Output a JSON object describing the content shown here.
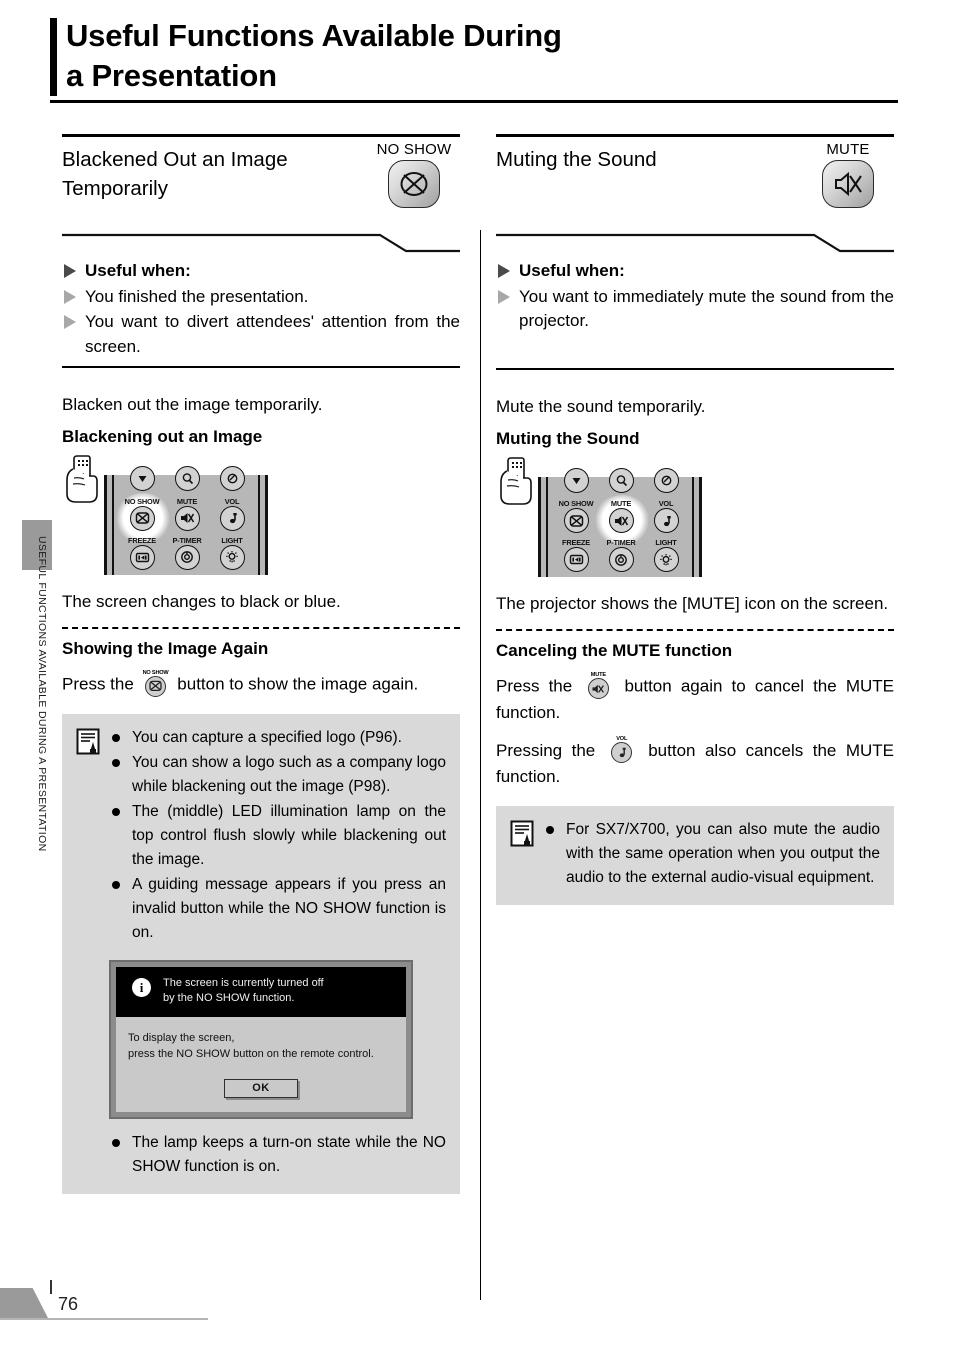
{
  "page": {
    "title_line1": "Useful Functions Available During",
    "title_line2": "a Presentation",
    "side_label": "USEFUL FUNCTIONS AVAILABLE DURING A PRESENTATION",
    "page_number": "76"
  },
  "left": {
    "section_title_line1": "Blackened Out an Image",
    "section_title_line2": "Temporarily",
    "badge_label": "NO SHOW",
    "badge_icon": "no-show-icon",
    "useful_when_heading": "Useful when:",
    "useful_when_items": [
      "You finished the presentation.",
      "You want to divert attendees' attention from the screen."
    ],
    "intro": "Blacken out the image temporarily.",
    "step_heading": "Blackening out an Image",
    "remote": {
      "hand_icon": "hand-holding-remote-icon",
      "highlighted_key": "NO SHOW",
      "rows": [
        [
          {
            "label": "",
            "glyph": "down-arrow-icon"
          },
          {
            "label": "",
            "glyph": "zoom-icon"
          },
          {
            "label": "",
            "glyph": "pointer-icon"
          }
        ],
        [
          {
            "label": "NO SHOW",
            "glyph": "no-show-icon"
          },
          {
            "label": "MUTE",
            "glyph": "mute-icon"
          },
          {
            "label": "VOL",
            "glyph": "volume-note-icon"
          }
        ],
        [
          {
            "label": "FREEZE",
            "glyph": "freeze-icon"
          },
          {
            "label": "P-TIMER",
            "glyph": "p-timer-icon"
          },
          {
            "label": "LIGHT",
            "glyph": "light-icon"
          }
        ]
      ]
    },
    "result": "The screen changes to black or blue.",
    "sub_heading_2": "Showing the Image Again",
    "press_sentence_a": "Press the",
    "press_key_label": "NO SHOW",
    "press_key_glyph": "no-show-icon",
    "press_sentence_b": "button to show the image again.",
    "note": {
      "icon": "memo-note-icon",
      "items": [
        "You can capture a specified logo (P96).",
        "You can show a logo such as a company logo while blackening out the image (P98).",
        "The (middle) LED illumination lamp on the top control flush slowly while blackening out the image.",
        "A guiding message appears if you press an invalid button while the NO SHOW function is on."
      ],
      "items_after_image": [
        "The lamp keeps a turn-on state while the NO SHOW function is on."
      ],
      "osd": {
        "info_icon": "info-icon",
        "top_line1": "The screen is currently turned off",
        "top_line2": "by the NO SHOW function.",
        "bottom_line1": "To display the screen,",
        "bottom_line2": "press the NO SHOW button on the remote control.",
        "ok_label": "OK"
      }
    }
  },
  "right": {
    "section_title_line1": "Muting the Sound",
    "section_title_line2": "",
    "badge_label": "MUTE",
    "badge_icon": "mute-icon",
    "useful_when_heading": "Useful when:",
    "useful_when_items": [
      "You want to immediately mute the sound from the projector."
    ],
    "intro": "Mute the sound temporarily.",
    "step_heading": "Muting the Sound",
    "remote": {
      "hand_icon": "hand-holding-remote-icon",
      "highlighted_key": "MUTE",
      "rows": [
        [
          {
            "label": "",
            "glyph": "down-arrow-icon"
          },
          {
            "label": "",
            "glyph": "zoom-icon"
          },
          {
            "label": "",
            "glyph": "pointer-icon"
          }
        ],
        [
          {
            "label": "NO SHOW",
            "glyph": "no-show-icon"
          },
          {
            "label": "MUTE",
            "glyph": "mute-icon"
          },
          {
            "label": "VOL",
            "glyph": "volume-note-icon"
          }
        ],
        [
          {
            "label": "FREEZE",
            "glyph": "freeze-icon"
          },
          {
            "label": "P-TIMER",
            "glyph": "p-timer-icon"
          },
          {
            "label": "LIGHT",
            "glyph": "light-icon"
          }
        ]
      ]
    },
    "result": "The projector shows the [MUTE] icon on the screen.",
    "sub_heading_2": "Canceling the MUTE function",
    "press1_a": "Press the",
    "press1_key_label": "MUTE",
    "press1_key_glyph": "mute-icon",
    "press1_b": "button again to cancel the MUTE function.",
    "press2_a": "Pressing the",
    "press2_key_label": "VOL",
    "press2_key_glyph": "volume-note-icon",
    "press2_b": "button also cancels the MUTE function.",
    "note": {
      "icon": "memo-note-icon",
      "items": [
        "For SX7/X700, you can also mute the audio with the same operation when you output the audio to the external audio-visual equipment."
      ]
    }
  },
  "colors": {
    "note_box_bg": "#d9d9d9",
    "remote_body": "#b7b7b7",
    "tab_gray": "#9a9a9a",
    "osd_header": "#000000",
    "osd_body": "#c9c9c9"
  }
}
